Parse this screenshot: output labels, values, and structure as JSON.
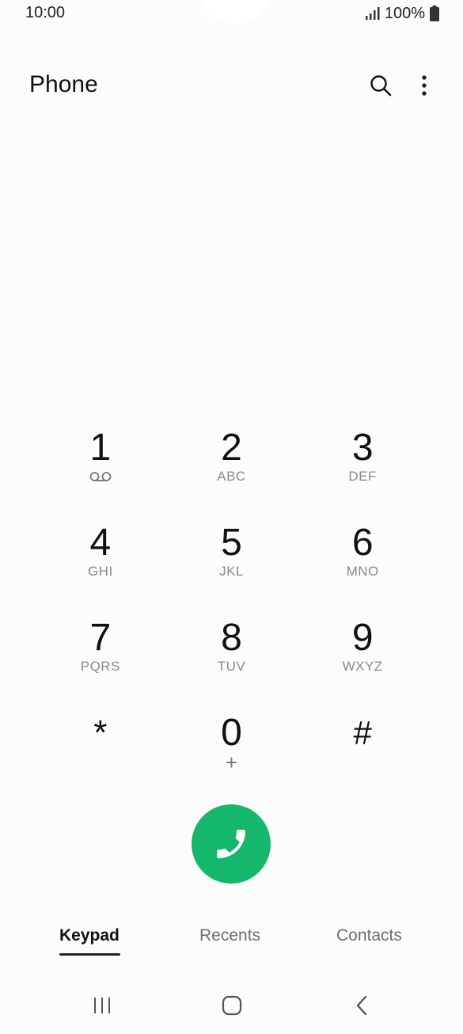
{
  "status_bar": {
    "time": "10:00",
    "battery": "100%",
    "icons": [
      "signal-icon",
      "battery-icon"
    ]
  },
  "header": {
    "title": "Phone",
    "actions": [
      "search-icon",
      "more-options-icon"
    ]
  },
  "keypad": {
    "keys": [
      {
        "digit": "1",
        "letters": "",
        "sub_icon": "voicemail-icon"
      },
      {
        "digit": "2",
        "letters": "ABC"
      },
      {
        "digit": "3",
        "letters": "DEF"
      },
      {
        "digit": "4",
        "letters": "GHI"
      },
      {
        "digit": "5",
        "letters": "JKL"
      },
      {
        "digit": "6",
        "letters": "MNO"
      },
      {
        "digit": "7",
        "letters": "PQRS"
      },
      {
        "digit": "8",
        "letters": "TUV"
      },
      {
        "digit": "9",
        "letters": "WXYZ"
      },
      {
        "digit": "*",
        "letters": ""
      },
      {
        "digit": "0",
        "letters": "+"
      },
      {
        "digit": "#",
        "letters": ""
      }
    ]
  },
  "call_button": {
    "icon": "phone-icon",
    "color": "#14b76b"
  },
  "tabs": [
    {
      "label": "Keypad",
      "active": true
    },
    {
      "label": "Recents",
      "active": false
    },
    {
      "label": "Contacts",
      "active": false
    }
  ],
  "nav_bar": {
    "icons": [
      "recent-apps-icon",
      "home-icon",
      "back-icon"
    ]
  }
}
